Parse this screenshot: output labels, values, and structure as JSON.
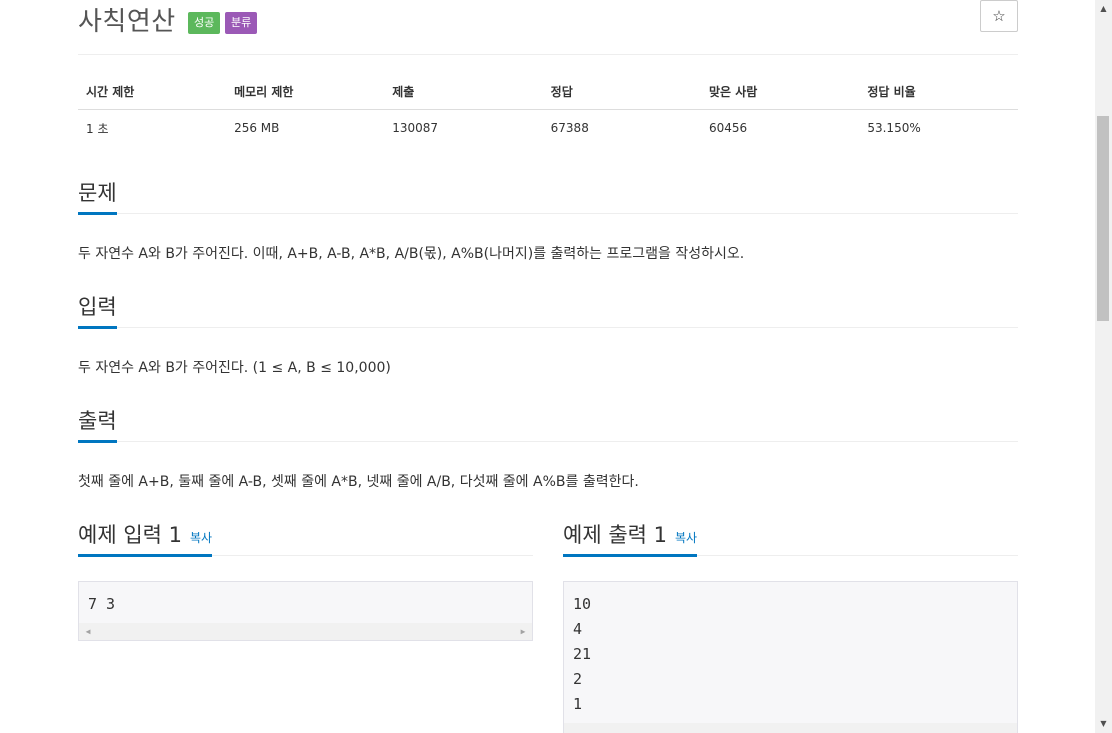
{
  "problem": {
    "title": "사칙연산",
    "badges": {
      "success": "성공",
      "category": "분류"
    },
    "star_icon": "☆"
  },
  "stats": {
    "headers": [
      "시간 제한",
      "메모리 제한",
      "제출",
      "정답",
      "맞은 사람",
      "정답 비율"
    ],
    "values": [
      "1 초",
      "256 MB",
      "130087",
      "67388",
      "60456",
      "53.150%"
    ]
  },
  "sections": {
    "problem": {
      "heading": "문제",
      "text": "두 자연수 A와 B가 주어진다. 이때, A+B, A-B, A*B, A/B(몫), A%B(나머지)를 출력하는 프로그램을 작성하시오."
    },
    "input": {
      "heading": "입력",
      "text": "두 자연수 A와 B가 주어진다. (1 ≤ A, B ≤ 10,000)"
    },
    "output": {
      "heading": "출력",
      "text": "첫째 줄에 A+B, 둘째 줄에 A-B, 셋째 줄에 A*B, 넷째 줄에 A/B, 다섯째 줄에 A%B를 출력한다."
    }
  },
  "examples": {
    "input": {
      "heading": "예제 입력 1",
      "copy": "복사",
      "lines": [
        "7 3"
      ]
    },
    "output": {
      "heading": "예제 출력 1",
      "copy": "복사",
      "lines": [
        "10",
        "4",
        "21",
        "2",
        "1"
      ]
    }
  },
  "colors": {
    "accent": "#0076c0",
    "success": "#5cb85c",
    "category": "#9b59b6"
  }
}
